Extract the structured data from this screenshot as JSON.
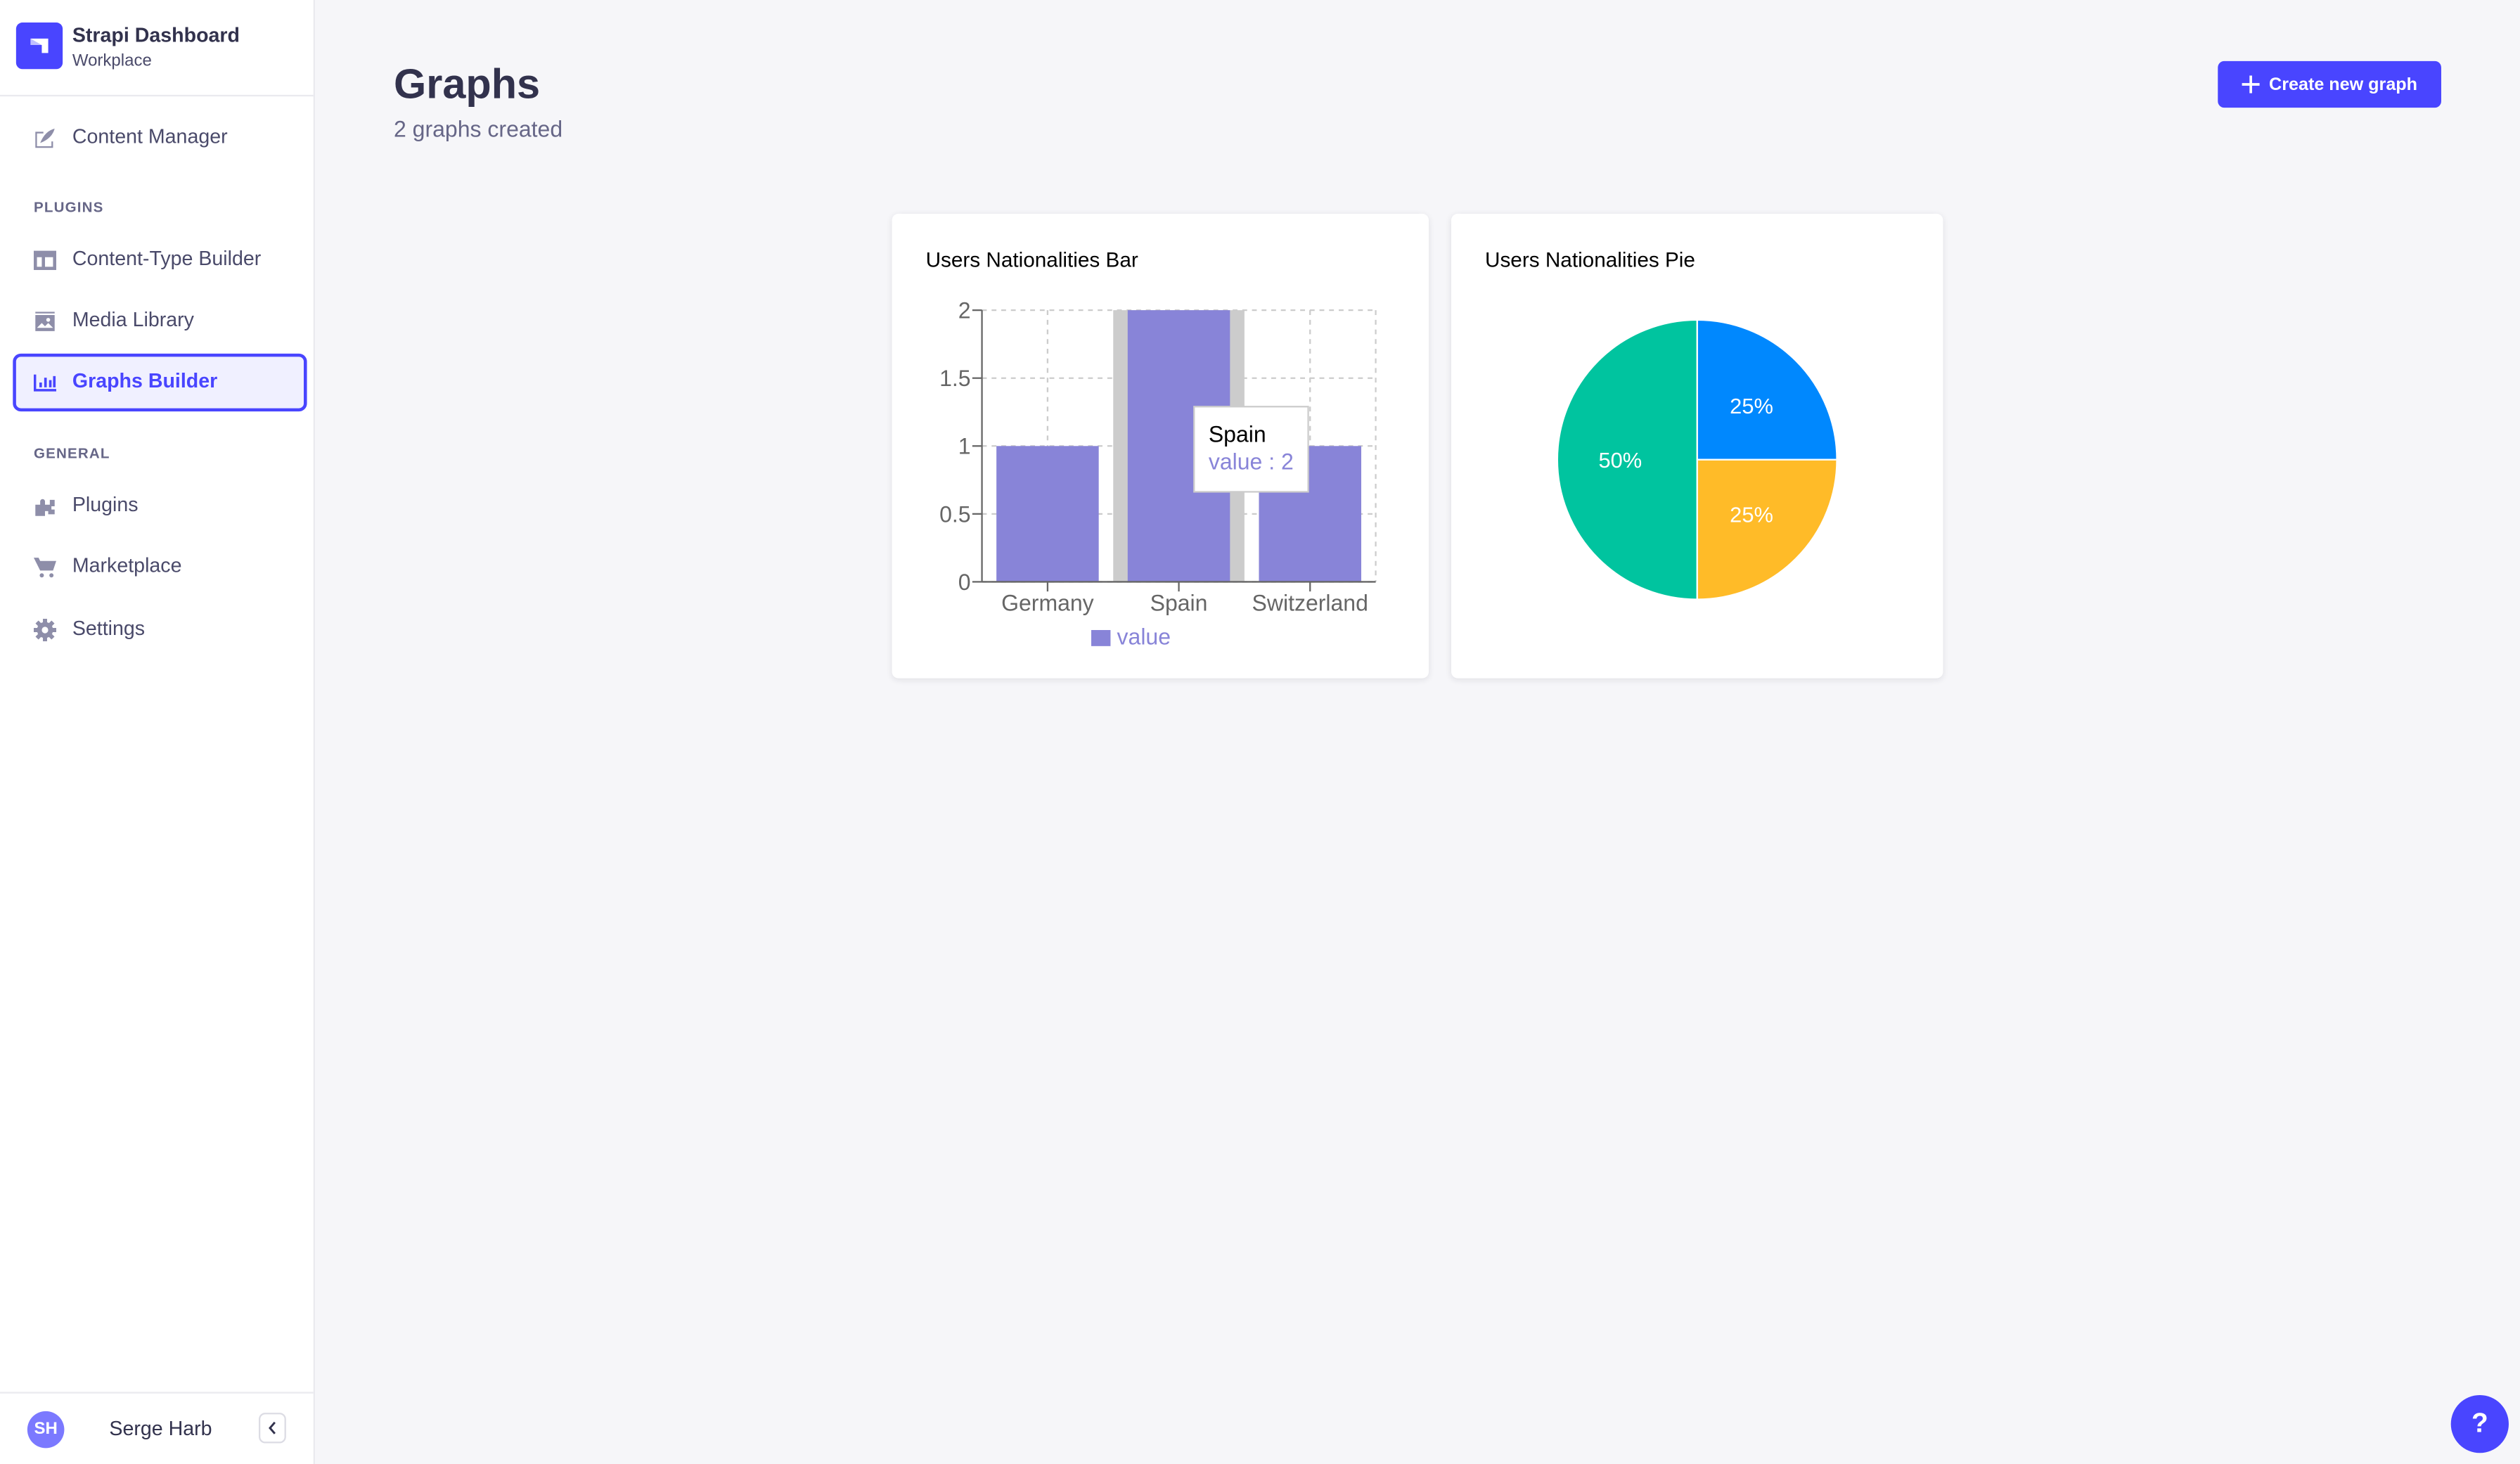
{
  "sidebar": {
    "brand": {
      "title": "Strapi Dashboard",
      "subtitle": "Workplace"
    },
    "items": [
      {
        "label": "Content Manager",
        "icon": "feather-icon"
      },
      {
        "label": "Content-Type Builder",
        "icon": "layout-icon"
      },
      {
        "label": "Media Library",
        "icon": "image-icon"
      },
      {
        "label": "Graphs Builder",
        "icon": "bar-chart-icon",
        "active": true
      },
      {
        "label": "Plugins",
        "icon": "puzzle-icon"
      },
      {
        "label": "Marketplace",
        "icon": "cart-icon"
      },
      {
        "label": "Settings",
        "icon": "gear-icon"
      }
    ],
    "sections": {
      "plugins": "PLUGINS",
      "general": "GENERAL"
    },
    "user": {
      "initials": "SH",
      "name": "Serge Harb"
    }
  },
  "header": {
    "title": "Graphs",
    "subtitle": "2 graphs created",
    "create_label": "Create new graph"
  },
  "colors": {
    "accent": "#4945ff",
    "bar": "#8884d8",
    "cursor": "#cccccc",
    "pie": [
      "#0088FE",
      "#FFBB28",
      "#00C49F"
    ]
  },
  "help_label": "?",
  "chart_data": [
    {
      "type": "bar",
      "title": "Users Nationalities Bar",
      "categories": [
        "Germany",
        "Spain",
        "Switzerland"
      ],
      "series": [
        {
          "name": "value",
          "values": [
            1,
            2,
            1
          ]
        }
      ],
      "yticks": [
        "0",
        "0.5",
        "1",
        "1.5",
        "2"
      ],
      "ylim": [
        0,
        2
      ],
      "grid": true,
      "legend": "bottom",
      "tooltip": {
        "title": "Spain",
        "text": "value : 2"
      }
    },
    {
      "type": "pie",
      "title": "Users Nationalities Pie",
      "values": [
        1,
        1,
        2
      ],
      "labels": [
        "25%",
        "25%",
        "50%"
      ]
    }
  ]
}
